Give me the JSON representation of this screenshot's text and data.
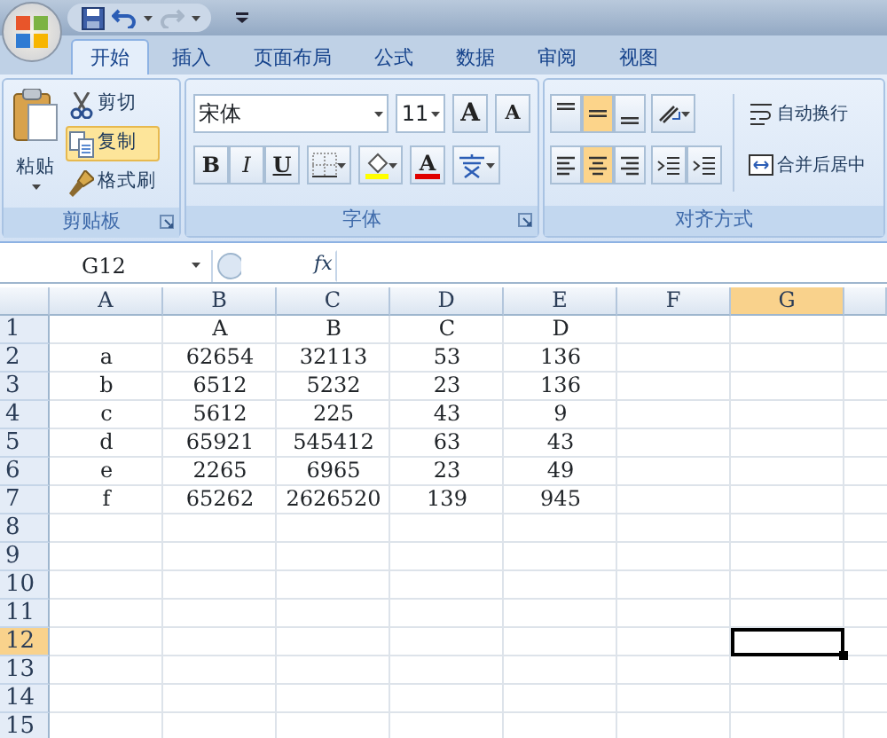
{
  "tabs": [
    {
      "label": "开始",
      "selected": true
    },
    {
      "label": "插入",
      "selected": false
    },
    {
      "label": "页面布局",
      "selected": false
    },
    {
      "label": "公式",
      "selected": false
    },
    {
      "label": "数据",
      "selected": false
    },
    {
      "label": "审阅",
      "selected": false
    },
    {
      "label": "视图",
      "selected": false
    }
  ],
  "ribbon": {
    "groups": [
      {
        "kind": "clipboard",
        "label": "剪贴板",
        "paste": "粘贴",
        "items": [
          {
            "kind": "cut",
            "label": "剪切",
            "selected": false
          },
          {
            "kind": "copy",
            "label": "复制",
            "selected": true
          },
          {
            "kind": "painter",
            "label": "格式刷",
            "selected": false
          }
        ]
      },
      {
        "kind": "font",
        "label": "字体",
        "font_name": "宋体",
        "font_size": "11",
        "size_buttons": [
          {
            "kind": "grow",
            "label": "A"
          },
          {
            "kind": "shrink",
            "label": "A"
          }
        ],
        "style_buttons": [
          {
            "kind": "bold",
            "label": "B",
            "selected": false
          },
          {
            "kind": "italic",
            "label": "I",
            "selected": false
          },
          {
            "kind": "underline",
            "label": "U",
            "selected": false
          }
        ],
        "font_color_label": "A"
      },
      {
        "kind": "alignment",
        "label": "对齐方式",
        "vertical": [
          {
            "kind": "top",
            "selected": false
          },
          {
            "kind": "middle",
            "selected": true
          },
          {
            "kind": "bottom",
            "selected": false
          }
        ],
        "horizontal": [
          {
            "kind": "left",
            "selected": false
          },
          {
            "kind": "center",
            "selected": true
          },
          {
            "kind": "right",
            "selected": false
          }
        ],
        "wrap_text": "自动换行",
        "merge_center": "合并后居中"
      }
    ]
  },
  "formula_bar": {
    "name_box": "G12",
    "fx": "fx"
  },
  "sheet": {
    "columns": [
      {
        "label": "A",
        "selected": false
      },
      {
        "label": "B",
        "selected": false
      },
      {
        "label": "C",
        "selected": false
      },
      {
        "label": "D",
        "selected": false
      },
      {
        "label": "E",
        "selected": false
      },
      {
        "label": "F",
        "selected": false
      },
      {
        "label": "G",
        "selected": true
      }
    ],
    "rows": [
      {
        "number": "1",
        "selected": false,
        "cells": [
          "",
          "A",
          "B",
          "C",
          "D"
        ]
      },
      {
        "number": "2",
        "selected": false,
        "cells": [
          "a",
          "62654",
          "32113",
          "53",
          "136"
        ]
      },
      {
        "number": "3",
        "selected": false,
        "cells": [
          "b",
          "6512",
          "5232",
          "23",
          "136"
        ]
      },
      {
        "number": "4",
        "selected": false,
        "cells": [
          "c",
          "5612",
          "225",
          "43",
          "9"
        ]
      },
      {
        "number": "5",
        "selected": false,
        "cells": [
          "d",
          "65921",
          "545412",
          "63",
          "43"
        ]
      },
      {
        "number": "6",
        "selected": false,
        "cells": [
          "e",
          "2265",
          "6965",
          "23",
          "49"
        ]
      },
      {
        "number": "7",
        "selected": false,
        "cells": [
          "f",
          "65262",
          "2626520",
          "139",
          "945"
        ]
      },
      {
        "number": "8",
        "selected": false,
        "cells": []
      },
      {
        "number": "9",
        "selected": false,
        "cells": []
      },
      {
        "number": "10",
        "selected": false,
        "cells": []
      },
      {
        "number": "11",
        "selected": false,
        "cells": []
      },
      {
        "number": "12",
        "selected": true,
        "cells": []
      },
      {
        "number": "13",
        "selected": false,
        "cells": []
      },
      {
        "number": "14",
        "selected": false,
        "cells": []
      },
      {
        "number": "15",
        "selected": false,
        "cells": []
      }
    ]
  }
}
